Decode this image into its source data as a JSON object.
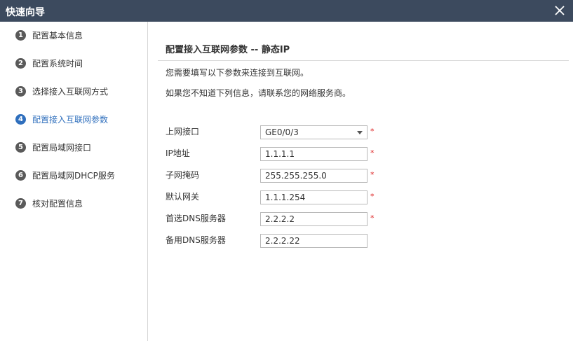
{
  "window": {
    "title": "快速向导"
  },
  "steps": [
    {
      "num": "1",
      "label": "配置基本信息"
    },
    {
      "num": "2",
      "label": "配置系统时间"
    },
    {
      "num": "3",
      "label": "选择接入互联网方式"
    },
    {
      "num": "4",
      "label": "配置接入互联网参数",
      "active": true
    },
    {
      "num": "5",
      "label": "配置局域网接口"
    },
    {
      "num": "6",
      "label": "配置局域网DHCP服务"
    },
    {
      "num": "7",
      "label": "核对配置信息"
    }
  ],
  "main": {
    "title": "配置接入互联网参数 -- 静态IP",
    "desc1": "您需要填写以下参数来连接到互联网。",
    "desc2": "如果您不知道下列信息，请联系您的网络服务商。"
  },
  "form": {
    "interface": {
      "label": "上网接口",
      "value": "GE0/0/3",
      "required": "*"
    },
    "ip": {
      "label": "IP地址",
      "value": "1.1.1.1",
      "required": "*"
    },
    "mask": {
      "label": "子网掩码",
      "value": "255.255.255.0",
      "required": "*"
    },
    "gateway": {
      "label": "默认网关",
      "value": "1.1.1.254",
      "required": "*"
    },
    "dns1": {
      "label": "首选DNS服务器",
      "value": "2.2.2.2",
      "required": "*"
    },
    "dns2": {
      "label": "备用DNS服务器",
      "value": "2.2.2.22"
    }
  },
  "colors": {
    "titlebar": "#3c4a5e",
    "accent": "#2f6fbd",
    "required": "#dd2222"
  },
  "icons": {
    "close": "close-icon",
    "dropdown": "chevron-down-icon"
  }
}
